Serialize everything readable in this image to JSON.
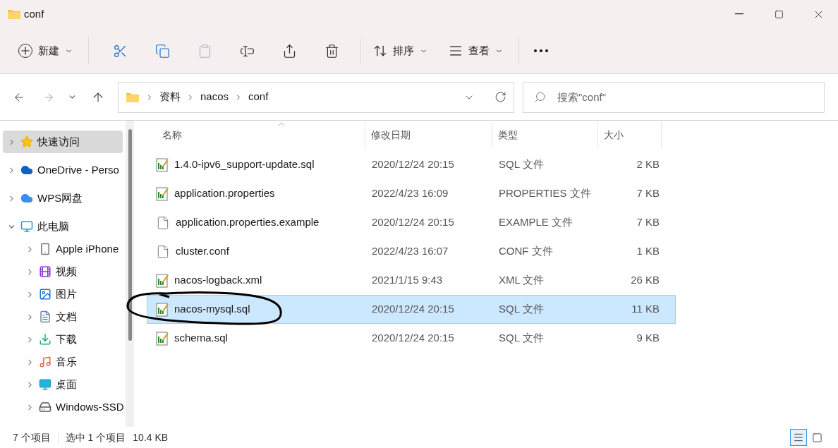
{
  "window": {
    "title": "conf"
  },
  "toolbar": {
    "new_label": "新建",
    "sort_label": "排序",
    "view_label": "查看"
  },
  "address": {
    "crumbs": [
      "资料",
      "nacos",
      "conf"
    ]
  },
  "search": {
    "placeholder": "搜索\"conf\""
  },
  "sidebar": {
    "items": [
      {
        "label": "快速访问",
        "kind": "star",
        "selected": true,
        "expanded": false
      },
      {
        "label": "OneDrive - Perso",
        "kind": "onedrive",
        "selected": false,
        "expanded": false
      },
      {
        "label": "WPS网盘",
        "kind": "cloud",
        "selected": false,
        "expanded": false
      },
      {
        "label": "此电脑",
        "kind": "pc",
        "selected": false,
        "expanded": true,
        "children": [
          {
            "label": "Apple iPhone",
            "kind": "phone",
            "selected": false,
            "expanded": false
          },
          {
            "label": "视频",
            "kind": "video",
            "selected": false,
            "expanded": false
          },
          {
            "label": "图片",
            "kind": "pictures",
            "selected": false,
            "expanded": false
          },
          {
            "label": "文档",
            "kind": "docs",
            "selected": false,
            "expanded": false
          },
          {
            "label": "下载",
            "kind": "download",
            "selected": false,
            "expanded": false
          },
          {
            "label": "音乐",
            "kind": "music",
            "selected": false,
            "expanded": false
          },
          {
            "label": "桌面",
            "kind": "desktop",
            "selected": false,
            "expanded": false
          },
          {
            "label": "Windows-SSD",
            "kind": "drive",
            "selected": false,
            "expanded": false
          }
        ]
      }
    ]
  },
  "table": {
    "columns": [
      "名称",
      "修改日期",
      "类型",
      "大小"
    ],
    "rows": [
      {
        "name": "1.4.0-ipv6_support-update.sql",
        "date": "2020/12/24 20:15",
        "type": "SQL 文件",
        "size": "2 KB",
        "kind": "sql",
        "selected": false
      },
      {
        "name": "application.properties",
        "date": "2022/4/23 16:09",
        "type": "PROPERTIES 文件",
        "size": "7 KB",
        "kind": "sql",
        "selected": false
      },
      {
        "name": "application.properties.example",
        "date": "2020/12/24 20:15",
        "type": "EXAMPLE 文件",
        "size": "7 KB",
        "kind": "plain",
        "selected": false
      },
      {
        "name": "cluster.conf",
        "date": "2022/4/23 16:07",
        "type": "CONF 文件",
        "size": "1 KB",
        "kind": "plain",
        "selected": false
      },
      {
        "name": "nacos-logback.xml",
        "date": "2021/1/15 9:43",
        "type": "XML 文件",
        "size": "26 KB",
        "kind": "sql",
        "selected": false
      },
      {
        "name": "nacos-mysql.sql",
        "date": "2020/12/24 20:15",
        "type": "SQL 文件",
        "size": "11 KB",
        "kind": "sql",
        "selected": true
      },
      {
        "name": "schema.sql",
        "date": "2020/12/24 20:15",
        "type": "SQL 文件",
        "size": "9 KB",
        "kind": "sql",
        "selected": false
      }
    ]
  },
  "status_bar": {
    "count": "7 个项目",
    "selection": "选中 1 个项目",
    "size": "10.4 KB",
    "view_details_selected": true,
    "view_tiles_selected": false
  }
}
